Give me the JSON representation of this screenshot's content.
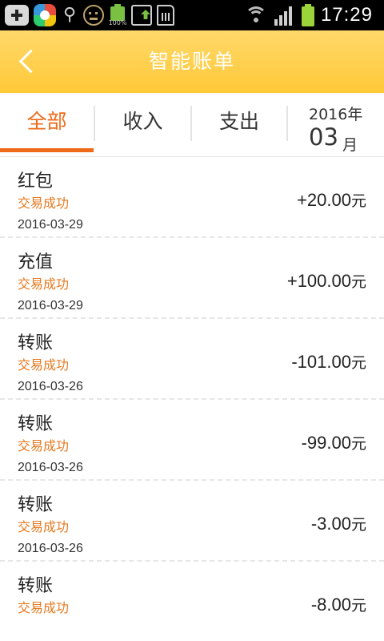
{
  "status_bar": {
    "time": "17:29",
    "battery_small_label": "100%",
    "icons": [
      "add-icon",
      "app-store-icon",
      "usb-icon",
      "face-icon",
      "battery-icon",
      "update-icon",
      "sim-icon",
      "wifi-icon",
      "signal-icon",
      "battery-icon"
    ]
  },
  "header": {
    "title": "智能账单",
    "back_icon": "chevron-left-icon"
  },
  "tabs": [
    {
      "label": "全部",
      "active": true
    },
    {
      "label": "收入",
      "active": false
    },
    {
      "label": "支出",
      "active": false
    }
  ],
  "date_filter": {
    "year": "2016年",
    "month": "03",
    "month_unit": "月"
  },
  "transactions": [
    {
      "title": "红包",
      "status": "交易成功",
      "date": "2016-03-29",
      "amount": "+20.00",
      "unit": "元"
    },
    {
      "title": "充值",
      "status": "交易成功",
      "date": "2016-03-29",
      "amount": "+100.00",
      "unit": "元"
    },
    {
      "title": "转账",
      "status": "交易成功",
      "date": "2016-03-26",
      "amount": "-101.00",
      "unit": "元"
    },
    {
      "title": "转账",
      "status": "交易成功",
      "date": "2016-03-26",
      "amount": "-99.00",
      "unit": "元"
    },
    {
      "title": "转账",
      "status": "交易成功",
      "date": "2016-03-26",
      "amount": "-3.00",
      "unit": "元"
    },
    {
      "title": "转账",
      "status": "交易成功",
      "date": "",
      "amount": "-8.00",
      "unit": "元"
    }
  ],
  "colors": {
    "accent": "#ee6a19",
    "header_top": "#ffd86a",
    "header_bottom": "#ffc938",
    "status_text": "#e8781e"
  }
}
